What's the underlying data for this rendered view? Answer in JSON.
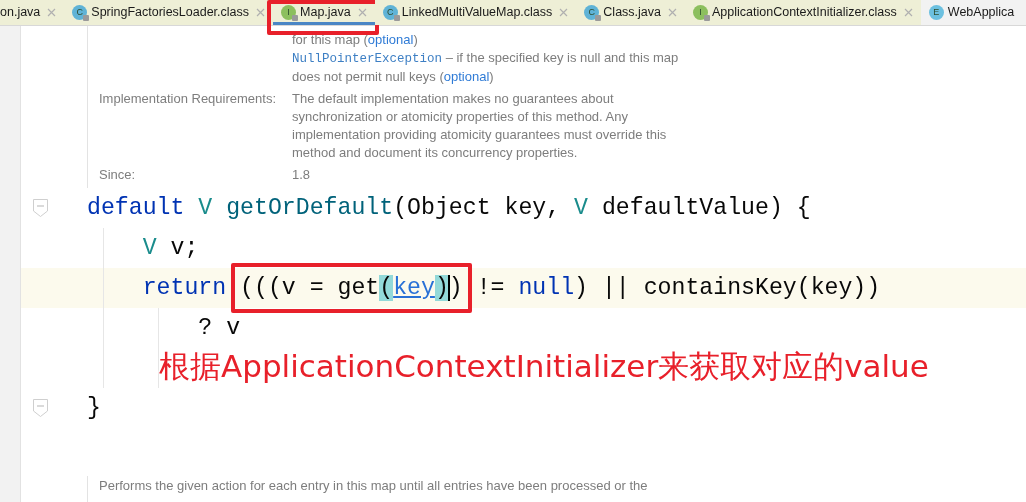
{
  "tabs": [
    {
      "label": "on.java",
      "closable": true,
      "selected": false,
      "tinted": true,
      "annotated": false
    },
    {
      "icon": "C",
      "color": "#5fb3d6",
      "locked": true,
      "label": "SpringFactoriesLoader.class",
      "closable": true,
      "selected": false,
      "tinted": true,
      "annotated": false
    },
    {
      "icon": "I",
      "color": "#8cbf5e",
      "locked": true,
      "label": "Map.java",
      "closable": true,
      "selected": true,
      "tinted": true,
      "annotated": true
    },
    {
      "icon": "C",
      "color": "#5fb3d6",
      "locked": true,
      "label": "LinkedMultiValueMap.class",
      "closable": true,
      "selected": false,
      "tinted": true,
      "annotated": false
    },
    {
      "icon": "C",
      "color": "#5fb3d6",
      "locked": true,
      "label": "Class.java",
      "closable": true,
      "selected": false,
      "tinted": true,
      "annotated": false
    },
    {
      "icon": "I",
      "color": "#8cbf5e",
      "locked": true,
      "label": "ApplicationContextInitializer.class",
      "closable": true,
      "selected": false,
      "tinted": true,
      "annotated": false
    },
    {
      "icon": "E",
      "color": "#6cc0e0",
      "locked": false,
      "label": "WebApplica",
      "closable": false,
      "selected": false,
      "tinted": false,
      "annotated": false
    }
  ],
  "doc_top": [
    {
      "value": [
        {
          "text": "for this map (",
          "kind": "plain"
        },
        {
          "text": "optional",
          "kind": "link"
        },
        {
          "text": ")",
          "kind": "plain"
        }
      ]
    },
    {
      "value": [
        {
          "text": "NullPointerException",
          "kind": "code"
        },
        {
          "text": " – if the specified key is null and this map does not permit null keys (",
          "kind": "plain"
        },
        {
          "text": "optional",
          "kind": "link"
        },
        {
          "text": ")",
          "kind": "plain"
        }
      ]
    },
    {
      "label": "Implementation Requirements:",
      "value": [
        {
          "text": "The default implementation makes no guarantees about synchronization or atomicity properties of this method. Any implementation providing atomicity guarantees must override this method and document its concurrency properties.",
          "kind": "plain"
        }
      ]
    },
    {
      "label": "Since:",
      "value": [
        {
          "text": "1.8",
          "kind": "plain"
        }
      ]
    }
  ],
  "code_lines": [
    {
      "fold": true,
      "tokens": [
        {
          "text": "default ",
          "kind": "keyword"
        },
        {
          "text": "V ",
          "kind": "type"
        },
        {
          "text": "getOrDefault",
          "kind": "method"
        },
        {
          "text": "(Object key, ",
          "kind": "plain"
        },
        {
          "text": "V",
          "kind": "type"
        },
        {
          "text": " defaultValue) {",
          "kind": "plain"
        }
      ]
    },
    {
      "tokens": [
        {
          "text": "    V",
          "kind": "type"
        },
        {
          "text": " v;",
          "kind": "plain"
        }
      ]
    },
    {
      "current": true,
      "tokens": [
        {
          "text": "    return ",
          "kind": "keyword"
        },
        {
          "kind": "group",
          "boxed": true,
          "children": [
            {
              "text": "(((v = get",
              "kind": "plain"
            },
            {
              "text": "(",
              "kind": "brace_match"
            },
            {
              "text": "key",
              "kind": "link"
            },
            {
              "text": ")",
              "kind": "brace_match"
            },
            {
              "kind": "cursor"
            },
            {
              "text": ")",
              "kind": "plain"
            }
          ]
        },
        {
          "text": " != ",
          "kind": "plain"
        },
        {
          "text": "null",
          "kind": "keyword"
        },
        {
          "text": ") || containsKey(key))",
          "kind": "plain"
        }
      ]
    },
    {
      "tokens": [
        {
          "text": "        ? v",
          "kind": "plain"
        }
      ]
    },
    {
      "annotation": "根据ApplicationContextInitializer来获取对应的value"
    },
    {
      "fold": true,
      "tokens": [
        {
          "text": "}",
          "kind": "plain"
        }
      ]
    }
  ],
  "doc_bottom": "Performs the given action for each entry in this map until all entries have been processed or the"
}
